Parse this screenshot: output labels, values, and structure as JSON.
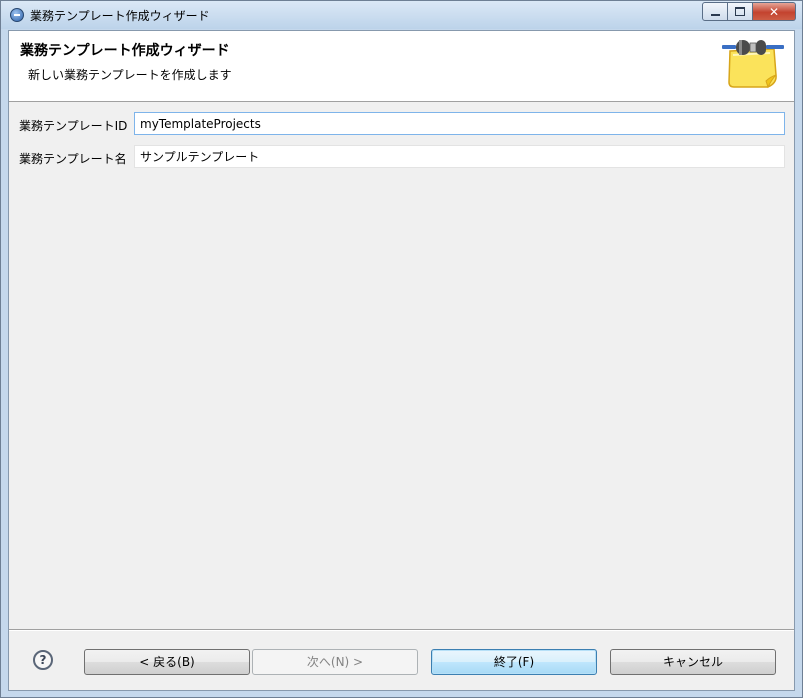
{
  "window": {
    "title": "業務テンプレート作成ウィザード",
    "caption_buttons": {
      "minimize": "minimize",
      "maximize": "maximize",
      "close": "✕"
    }
  },
  "header": {
    "title": "業務テンプレート作成ウィザード",
    "description": "新しい業務テンプレートを作成します",
    "image_icon": "template-note-plug-icon"
  },
  "form": {
    "template_id": {
      "label": "業務テンプレートID",
      "value": "myTemplateProjects"
    },
    "template_name": {
      "label": "業務テンプレート名",
      "value": "サンプルテンプレート"
    }
  },
  "buttons": {
    "help": "?",
    "back": "< 戻る(B)",
    "next": "次へ(N) >",
    "finish": "終了(F)",
    "cancel": "キャンセル"
  },
  "colors": {
    "title_bar": "#c5d8ec",
    "dialog_background": "#f0f0f0",
    "header_background": "#ffffff",
    "close_button": "#c3432f",
    "default_button": "#bee6fd"
  }
}
